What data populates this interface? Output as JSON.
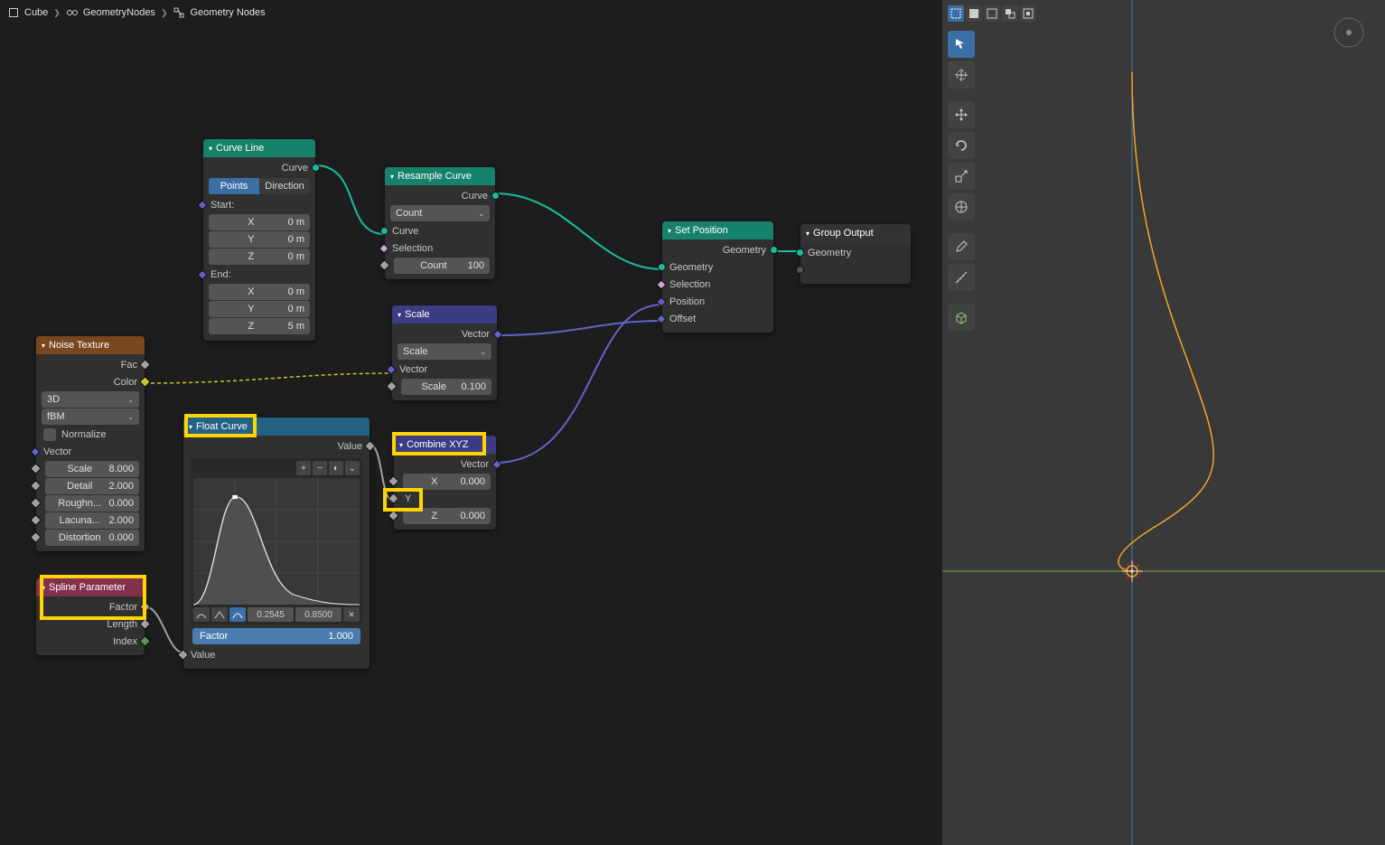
{
  "breadcrumb": [
    {
      "icon": "cube",
      "label": "Cube"
    },
    {
      "icon": "modifier",
      "label": "GeometryNodes"
    },
    {
      "icon": "nodetree",
      "label": "Geometry Nodes"
    }
  ],
  "nodes": {
    "curve_line": {
      "title": "Curve Line",
      "outputs": {
        "curve": "Curve"
      },
      "mode_options": [
        "Points",
        "Direction"
      ],
      "mode_active": "Points",
      "start_label": "Start:",
      "end_label": "End:",
      "start": {
        "x_label": "X",
        "x_val": "0 m",
        "y_label": "Y",
        "y_val": "0 m",
        "z_label": "Z",
        "z_val": "0 m"
      },
      "end": {
        "x_label": "X",
        "x_val": "0 m",
        "y_label": "Y",
        "y_val": "0 m",
        "z_label": "Z",
        "z_val": "5 m"
      }
    },
    "resample": {
      "title": "Resample Curve",
      "outputs": {
        "curve": "Curve"
      },
      "mode": "Count",
      "inputs": {
        "curve": "Curve",
        "selection": "Selection",
        "count_label": "Count",
        "count_val": "100"
      }
    },
    "set_position": {
      "title": "Set Position",
      "outputs": {
        "geometry": "Geometry"
      },
      "inputs": {
        "geometry": "Geometry",
        "selection": "Selection",
        "position": "Position",
        "offset": "Offset"
      }
    },
    "group_output": {
      "title": "Group Output",
      "inputs": {
        "geometry": "Geometry"
      }
    },
    "noise": {
      "title": "Noise Texture",
      "outputs": {
        "fac": "Fac",
        "color": "Color"
      },
      "dim": "3D",
      "basis": "fBM",
      "normalize": "Normalize",
      "inputs": {
        "vector": "Vector",
        "scale_label": "Scale",
        "scale_val": "8.000",
        "detail_label": "Detail",
        "detail_val": "2.000",
        "rough_label": "Roughn...",
        "rough_val": "0.000",
        "lac_label": "Lacuna...",
        "lac_val": "2.000",
        "dist_label": "Distortion",
        "dist_val": "0.000"
      }
    },
    "spline_param": {
      "title": "Spline Parameter",
      "outputs": {
        "factor": "Factor",
        "length": "Length",
        "index": "Index"
      }
    },
    "float_curve": {
      "title": "Float Curve",
      "outputs": {
        "value": "Value"
      },
      "point_x": "0.2545",
      "point_y": "0.8500",
      "factor_label": "Factor",
      "factor_val": "1.000",
      "inputs": {
        "value": "Value"
      }
    },
    "combine_xyz": {
      "title": "Combine XYZ",
      "outputs": {
        "vector": "Vector"
      },
      "x_label": "X",
      "x_val": "0.000",
      "y_label": "Y",
      "z_label": "Z",
      "z_val": "0.000"
    },
    "scale_node": {
      "title": "Scale",
      "outputs": {
        "vector": "Vector"
      },
      "mode": "Scale",
      "inputs": {
        "vector": "Vector",
        "scale_label": "Scale",
        "scale_val": "0.100"
      }
    }
  },
  "viewport": {
    "tools": [
      "select-box",
      "cursor",
      "move",
      "rotate",
      "scale",
      "transform",
      "annotate",
      "measure",
      "add-cube"
    ]
  }
}
